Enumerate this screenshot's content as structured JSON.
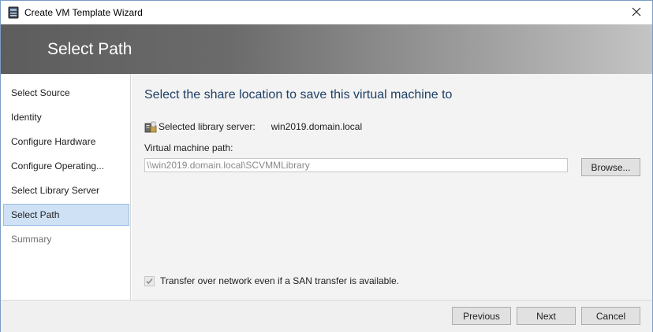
{
  "window": {
    "title": "Create VM Template Wizard",
    "icon": "wizard-window-icon",
    "close_icon": "close-icon"
  },
  "header": {
    "title": "Select Path"
  },
  "nav": {
    "items": [
      {
        "label": "Select Source",
        "state": "normal"
      },
      {
        "label": "Identity",
        "state": "normal"
      },
      {
        "label": "Configure Hardware",
        "state": "normal"
      },
      {
        "label": "Configure Operating...",
        "state": "normal"
      },
      {
        "label": "Select Library Server",
        "state": "normal"
      },
      {
        "label": "Select Path",
        "state": "selected"
      },
      {
        "label": "Summary",
        "state": "disabled"
      }
    ],
    "selected_color": "#cfe1f5"
  },
  "main": {
    "heading": "Select the share location to save this virtual machine to",
    "server_label": "Selected library server:",
    "server_value": "win2019.domain.local",
    "server_icon": "library-server-icon",
    "path_label": "Virtual machine path:",
    "path_value": "\\\\win2019.domain.local\\SCVMMLibrary",
    "browse_label": "Browse...",
    "transfer_checkbox": {
      "label": "Transfer over network even if a SAN transfer is available.",
      "checked": true,
      "disabled": true
    }
  },
  "footer": {
    "previous_label": "Previous",
    "next_label": "Next",
    "cancel_label": "Cancel"
  },
  "colors": {
    "heading": "#1f3f66",
    "header_dark": "#5d5d5d",
    "header_light": "#c4c4c4",
    "content_bg": "#f3f3f3"
  }
}
